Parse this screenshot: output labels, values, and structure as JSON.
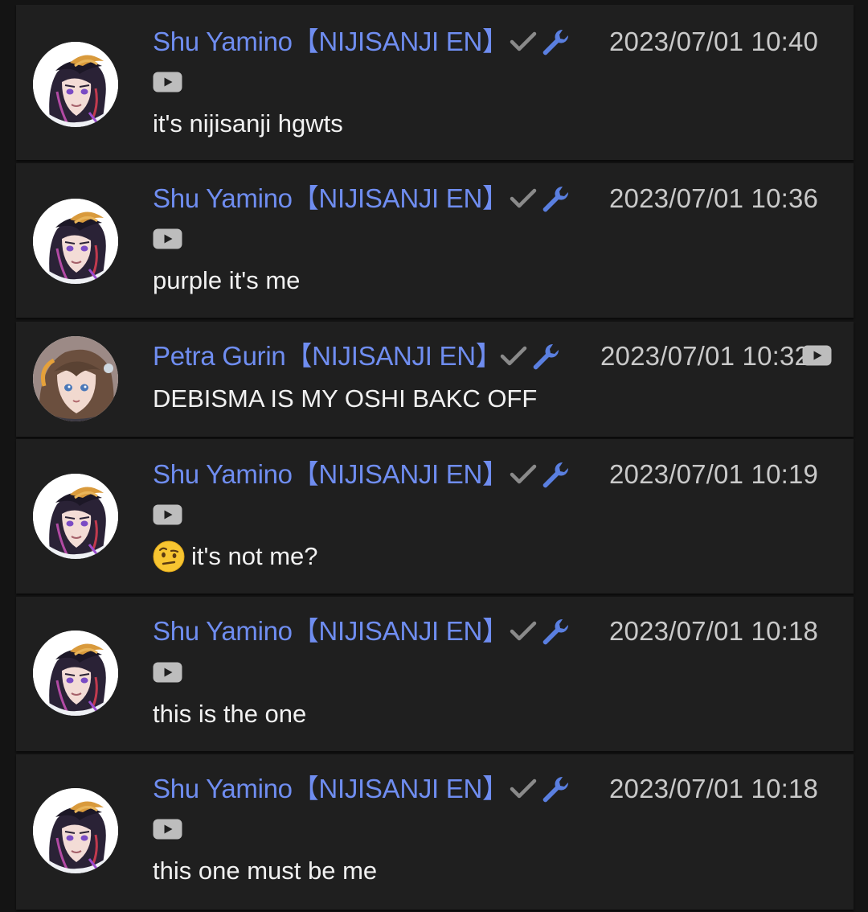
{
  "colors": {
    "background": "#141414",
    "card": "#1f1f1f",
    "author": "#6f8df0",
    "timestamp": "#c9c9c9",
    "message": "#f1f1f1",
    "verified_check": "#8a8a8a",
    "moderator_wrench": "#5a7fe0",
    "youtube_badge": "#bdbdbd"
  },
  "messages": [
    {
      "author": "Shu Yamino【NIJISANJI EN】",
      "timestamp": "2023/07/01 10:40",
      "icons": [
        "checkmark-icon",
        "wrench-icon",
        "youtube-icon"
      ],
      "text": "it's nijisanji hgwts"
    },
    {
      "author": "Shu Yamino【NIJISANJI EN】",
      "timestamp": "2023/07/01 10:36",
      "icons": [
        "checkmark-icon",
        "wrench-icon",
        "youtube-icon"
      ],
      "text": "purple it's me"
    },
    {
      "author": "Petra Gurin【NIJISANJI EN】",
      "timestamp": "2023/07/01 10:32",
      "icons": [
        "checkmark-icon",
        "wrench-icon",
        "youtube-icon"
      ],
      "text": "DEBISMA IS MY OSHI BAKC OFF"
    },
    {
      "author": "Shu Yamino【NIJISANJI EN】",
      "timestamp": "2023/07/01 10:19",
      "icons": [
        "checkmark-icon",
        "wrench-icon",
        "youtube-icon"
      ],
      "emoji": "face-with-raised-eyebrow",
      "text": "it's not me?"
    },
    {
      "author": "Shu Yamino【NIJISANJI EN】",
      "timestamp": "2023/07/01 10:18",
      "icons": [
        "checkmark-icon",
        "wrench-icon",
        "youtube-icon"
      ],
      "text": "this is the one"
    },
    {
      "author": "Shu Yamino【NIJISANJI EN】",
      "timestamp": "2023/07/01 10:18",
      "icons": [
        "checkmark-icon",
        "wrench-icon",
        "youtube-icon"
      ],
      "text": "this one must be me"
    }
  ]
}
